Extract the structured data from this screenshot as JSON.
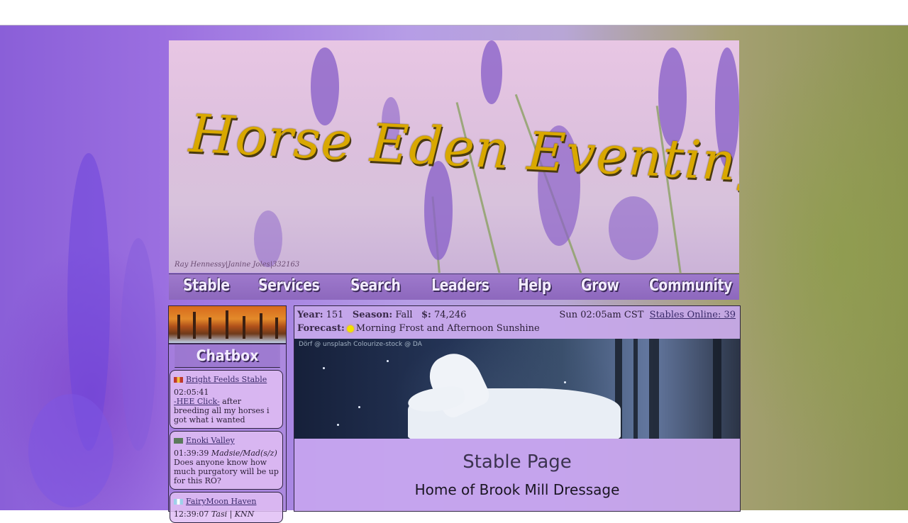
{
  "header": {
    "logo_text": "Horse Eden Eventing",
    "credit": "Ray Hennessy|Janine Joles|332163"
  },
  "nav": {
    "items": [
      {
        "label": "Stable"
      },
      {
        "label": "Services"
      },
      {
        "label": "Search"
      },
      {
        "label": "Leaders"
      },
      {
        "label": "Help"
      },
      {
        "label": "Grow"
      },
      {
        "label": "Community"
      }
    ]
  },
  "chatbox": {
    "title": "Chatbox",
    "posts": [
      {
        "stable": "Bright Feelds Stable",
        "time": "02:05:41",
        "user": "",
        "link": "-HEE Click-",
        "message": " after breeding all my horses i got what i wanted",
        "flag_color": "#c0392b"
      },
      {
        "stable": "Enoki Valley",
        "time": "01:39:39",
        "user": "Madsie/Mad(s/z)",
        "link": "",
        "message": "Does anyone know how much purgatory will be up for this RO?",
        "flag_color": "#5c7a5c"
      },
      {
        "stable": "FairyMoon Haven",
        "time": "12:39:07",
        "user": "Tasi | KNN",
        "link": "",
        "message": "",
        "flag_color": "#9fd0ea"
      }
    ]
  },
  "status": {
    "year_label": "Year:",
    "year": "151",
    "season_label": "Season:",
    "season": "Fall",
    "money_label": "$:",
    "money": "74,246",
    "clock": "Sun 02:05am CST",
    "online": "Stables Online: 39",
    "forecast_label": "Forecast:",
    "forecast": "Morning Frost and Afternoon Sunshine"
  },
  "banner": {
    "watermark": "Dörf @ unsplash    Colourize-stock @ DA"
  },
  "page": {
    "title": "Stable Page",
    "subtitle": "Home of Brook Mill Dressage"
  }
}
